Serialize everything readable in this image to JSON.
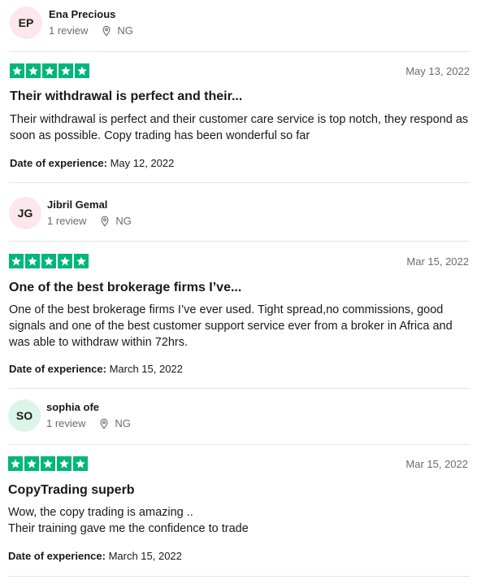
{
  "reviews": [
    {
      "initials": "EP",
      "avatar_color": "#fce7ed",
      "name": "Ena Precious",
      "review_count": "1 review",
      "country": "NG",
      "rating": 5,
      "date": "May 13, 2022",
      "title": "Their withdrawal is perfect and their...",
      "body": "Their withdrawal is perfect and their customer care service is top notch, they respond as soon as possible. Copy trading has been wonderful so far",
      "experience_label": "Date of experience:",
      "experience_date": "May 12, 2022"
    },
    {
      "initials": "JG",
      "avatar_color": "#fce7ed",
      "name": "Jibril Gemal",
      "review_count": "1 review",
      "country": "NG",
      "rating": 5,
      "date": "Mar 15, 2022",
      "title": "One of the best brokerage firms I’ve...",
      "body": "One of the best brokerage firms I’ve ever used. Tight spread,no commissions, good signals and one of the best customer support service ever from a broker in Africa and was able to withdraw within 72hrs.",
      "experience_label": "Date of experience:",
      "experience_date": "March 15, 2022"
    },
    {
      "initials": "SO",
      "avatar_color": "#dcf5ea",
      "name": "sophia ofe",
      "review_count": "1 review",
      "country": "NG",
      "rating": 5,
      "date": "Mar 15, 2022",
      "title": "CopyTrading superb",
      "body": "Wow, the copy trading is amazing ..\nTheir training gave me the confidence to trade",
      "experience_label": "Date of experience:",
      "experience_date": "March 15, 2022"
    }
  ],
  "colors": {
    "star_green": "#00b67a",
    "muted_text": "#6b6b6b",
    "divider": "#e5e5dd"
  },
  "icons": {
    "location": "location-pin-icon",
    "star": "star-icon"
  }
}
